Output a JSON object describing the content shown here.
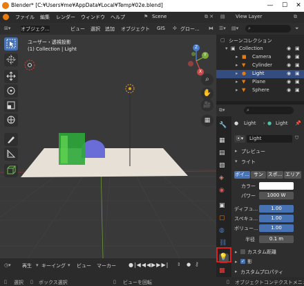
{
  "window": {
    "title": "Blender* [C:¥Users¥me¥AppData¥Local¥Temp¥02e.blend]",
    "minimize": "—",
    "maximize": "☐",
    "close": "✕"
  },
  "menu": {
    "items": [
      "ファイル",
      "編集",
      "レンダー",
      "ウィンドウ",
      "ヘルプ"
    ],
    "workspace": "Scene",
    "view_layer": "View Layer"
  },
  "viewport_header": {
    "mode": "オブジェク...",
    "view": "ビュー",
    "select": "選択",
    "add": "追加",
    "object": "オブジェクト",
    "gis": "GIS",
    "transform": "グロー..."
  },
  "viewport": {
    "view_name": "ユーザー・透視投影",
    "collection_info": "(1) Collection | Light"
  },
  "gizmo": {
    "z": "Z",
    "y": "Y",
    "x": "X"
  },
  "outliner": {
    "rows": [
      {
        "label": "シーンコレクション"
      },
      {
        "label": "Collection"
      },
      {
        "label": "Camera"
      },
      {
        "label": "Cylinder"
      },
      {
        "label": "Light"
      },
      {
        "label": "Plane"
      },
      {
        "label": "Sphere"
      }
    ]
  },
  "properties": {
    "object_name": "Light",
    "data_name": "Light",
    "datablock": "Light",
    "preview": "プレビュー",
    "light": "ライト",
    "light_types": [
      "ポイ...",
      "サン",
      "スポ...",
      "エリア"
    ],
    "color_label": "カラー",
    "power_label": "パワー",
    "power_value": "1000 W",
    "diffuse_label": "ディフュ...",
    "diffuse_value": "1.00",
    "specular_label": "スペキュ...",
    "specular_value": "1.00",
    "volume_label": "ボリュー...",
    "volume_value": "1.00",
    "radius_label": "半径",
    "radius_value": "0.1 m",
    "custom_distance": "カスタム距離",
    "shadow": "影",
    "custom_props": "カスタムプロパティ"
  },
  "timeline": {
    "play": "再生",
    "keying": "キーイング",
    "view": "ビュー",
    "marker": "マーカー"
  },
  "statusbar": {
    "select": "選択",
    "box_select": "ボックス選択",
    "rotate": "ビューを回転",
    "context_menu": "オブジェクトコンテクストメニュー"
  },
  "colors": {
    "accent": "#4772b3",
    "highlight_box": "#e02020",
    "light_icon": "#4fc3a8",
    "object_orange": "#e87d0d"
  }
}
